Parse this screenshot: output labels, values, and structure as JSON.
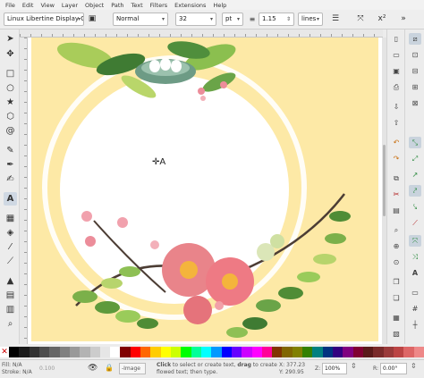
{
  "menu": [
    "File",
    "Edit",
    "View",
    "Layer",
    "Object",
    "Path",
    "Text",
    "Filters",
    "Extensions",
    "Help"
  ],
  "toolbar": {
    "font_family": "Linux Libertine Display O",
    "font_style": "Normal",
    "font_size": "32",
    "unit": "pt",
    "line_spacing": "1.15",
    "spacing_unit": "lines"
  },
  "status": {
    "fill_label": "Fill:",
    "fill_value": "N/A",
    "stroke_label": "Stroke:",
    "stroke_value": "N/A",
    "opacity": "0.100",
    "layer": "-Image",
    "message_pre": "Click",
    "message_mid": " to select or create text, ",
    "message_drag": "drag",
    "message_line1_end": " to create",
    "message_line2": "flowed text; then type.",
    "x_label": "X:",
    "x_value": "377.23",
    "y_label": "Y:",
    "y_value": "290.95",
    "z_label": "Z:",
    "zoom": "100%",
    "r_label": "R:",
    "rotation": "0.00°"
  },
  "palette_colors": [
    "#000000",
    "#1a1a1a",
    "#333333",
    "#4d4d4d",
    "#666666",
    "#808080",
    "#999999",
    "#b3b3b3",
    "#cccccc",
    "#e6e6e6",
    "#ffffff",
    "#800000",
    "#ff0000",
    "#ff6600",
    "#ffcc00",
    "#ffff00",
    "#ccff00",
    "#00ff00",
    "#00ff99",
    "#00ffff",
    "#0099ff",
    "#0000ff",
    "#6600ff",
    "#cc00ff",
    "#ff00ff",
    "#ff0099",
    "#803300",
    "#806600",
    "#808000",
    "#338000",
    "#008080",
    "#003380",
    "#330080",
    "#800080",
    "#800033",
    "#5a1a1a",
    "#7a2a2a",
    "#9a3a3a",
    "#bb4444",
    "#dd6666",
    "#ee8888"
  ]
}
